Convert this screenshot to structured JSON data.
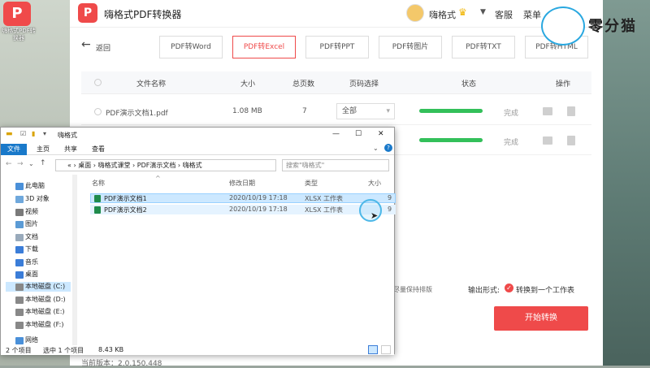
{
  "desktop": {
    "shortcut_label": "嗨格式PDF转换器"
  },
  "app": {
    "title": "嗨格式PDF转换器",
    "user": "嗨格式",
    "service": "客服",
    "menu": "菜单",
    "brand": "零分猫",
    "back": "返回",
    "tabs": [
      {
        "label": "PDF转Word"
      },
      {
        "label": "PDF转Excel"
      },
      {
        "label": "PDF转PPT"
      },
      {
        "label": "PDF转图片"
      },
      {
        "label": "PDF转TXT"
      },
      {
        "label": "PDF转HTML"
      }
    ],
    "table": {
      "headers": [
        "文件名称",
        "大小",
        "总页数",
        "页码选择",
        "状态",
        "操作"
      ],
      "rows": [
        {
          "name": "PDF演示文档1.pdf",
          "size": "1.08 MB",
          "pages": "7",
          "range": "全部",
          "progress": 1.0,
          "status": "完成"
        },
        {
          "name": "",
          "size": "",
          "pages": "",
          "range": "",
          "progress": 1.0,
          "status": "完成"
        }
      ]
    },
    "option_partial": "尽量保持排版",
    "output_label": "输出形式:",
    "output_value": "转换到一个工作表",
    "start": "开始转换",
    "version": "当前版本：2.0.150.448"
  },
  "explorer": {
    "title": "嗨格式",
    "ribbon": [
      "文件",
      "主页",
      "共享",
      "查看"
    ],
    "breadcrumb": [
      "«",
      "桌面",
      "嗨格式课堂",
      "PDF演示文档",
      "嗨格式"
    ],
    "search_placeholder": "搜索\"嗨格式\"",
    "nav": [
      "此电脑",
      "3D 对象",
      "视频",
      "图片",
      "文档",
      "下载",
      "音乐",
      "桌面",
      "本地磁盘 (C:)",
      "本地磁盘 (D:)",
      "本地磁盘 (E:)",
      "本地磁盘 (F:)",
      "网络"
    ],
    "columns": [
      "名称",
      "修改日期",
      "类型",
      "大小"
    ],
    "files": [
      {
        "name": "PDF演示文档1",
        "date": "2020/10/19 17:18",
        "type": "XLSX 工作表",
        "size": "9"
      },
      {
        "name": "PDF演示文档2",
        "date": "2020/10/19 17:18",
        "type": "XLSX 工作表",
        "size": "9"
      }
    ],
    "status": {
      "count": "2 个项目",
      "selected": "选中 1 个项目",
      "size": "8.43 KB"
    }
  },
  "colors": {
    "accent": "#ef4a4a",
    "progress": "#33c05a",
    "selection": "#cce8ff"
  }
}
